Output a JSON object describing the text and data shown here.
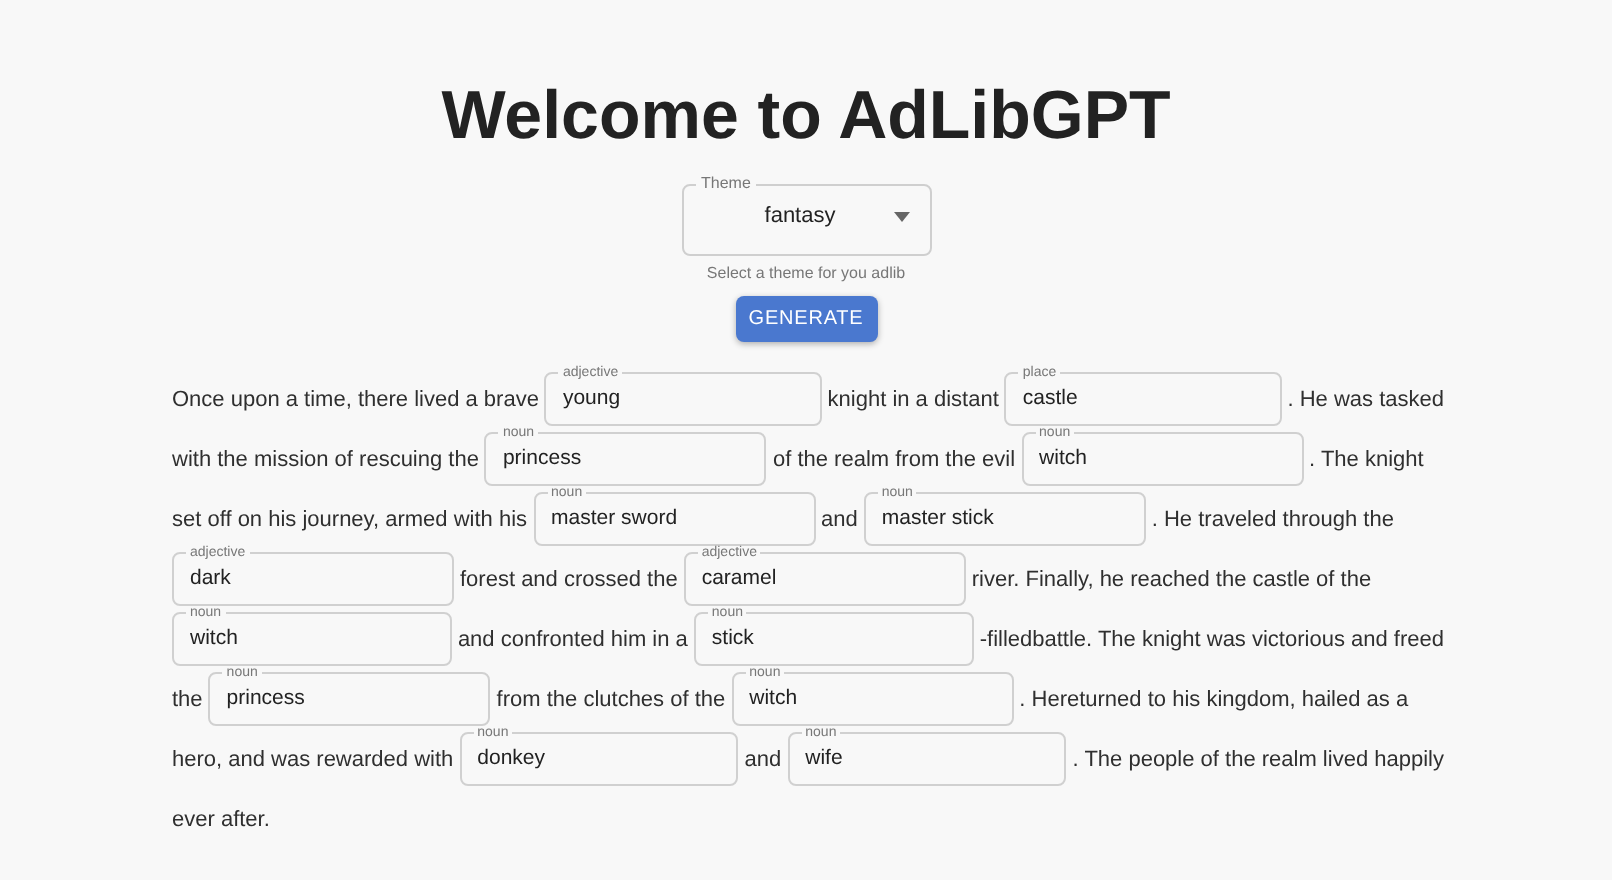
{
  "title": "Welcome to AdLibGPT",
  "theme_select": {
    "label": "Theme",
    "value": "fantasy",
    "helper": "Select a theme for you adlib"
  },
  "generate_button": "GENERATE",
  "story_lines": [
    {
      "parts": [
        {
          "kind": "text",
          "text": "Once upon a time, there lived a brave"
        },
        {
          "kind": "field",
          "label": "adjective",
          "value": "young"
        },
        {
          "kind": "text",
          "text": "knight in a distant"
        },
        {
          "kind": "field",
          "label": "place",
          "value": "castle"
        },
        {
          "kind": "text",
          "text": ". He was tasked"
        }
      ]
    },
    {
      "parts": [
        {
          "kind": "text",
          "text": "with the mission of rescuing the"
        },
        {
          "kind": "field",
          "label": "noun",
          "value": "princess"
        },
        {
          "kind": "text",
          "text": "of the realm from the evil"
        },
        {
          "kind": "field",
          "label": "noun",
          "value": "witch"
        },
        {
          "kind": "text",
          "text": ". The knight"
        }
      ]
    },
    {
      "parts": [
        {
          "kind": "text",
          "text": "set off on his journey, armed with his"
        },
        {
          "kind": "field",
          "label": "noun",
          "value": "master sword"
        },
        {
          "kind": "text",
          "text": "and"
        },
        {
          "kind": "field",
          "label": "noun",
          "value": "master stick"
        },
        {
          "kind": "text",
          "text": ". He traveled through the"
        }
      ]
    },
    {
      "parts": [
        {
          "kind": "field",
          "label": "adjective",
          "value": "dark"
        },
        {
          "kind": "text",
          "text": "forest and crossed the"
        },
        {
          "kind": "field",
          "label": "adjective",
          "value": "caramel"
        },
        {
          "kind": "text",
          "text": "river. Finally, he reached the castle of the"
        }
      ]
    },
    {
      "parts": [
        {
          "kind": "field",
          "label": "noun",
          "value": "witch"
        },
        {
          "kind": "text",
          "text": "and confronted him in a"
        },
        {
          "kind": "field",
          "label": "noun",
          "value": "stick"
        },
        {
          "kind": "text",
          "text": "-filledbattle. The knight was victorious and freed"
        }
      ]
    },
    {
      "parts": [
        {
          "kind": "text",
          "text": "the"
        },
        {
          "kind": "field",
          "label": "noun",
          "value": "princess"
        },
        {
          "kind": "text",
          "text": "from the clutches of the"
        },
        {
          "kind": "field",
          "label": "noun",
          "value": "witch"
        },
        {
          "kind": "text",
          "text": ". Hereturned to his kingdom, hailed as a"
        }
      ]
    },
    {
      "parts": [
        {
          "kind": "text",
          "text": "hero, and was rewarded with"
        },
        {
          "kind": "field",
          "label": "noun",
          "value": "donkey"
        },
        {
          "kind": "text",
          "text": "and"
        },
        {
          "kind": "field",
          "label": "noun",
          "value": "wife"
        },
        {
          "kind": "text",
          "text": ". The people of the realm lived happily"
        }
      ]
    },
    {
      "parts": [
        {
          "kind": "text",
          "text": "ever after."
        }
      ]
    }
  ]
}
